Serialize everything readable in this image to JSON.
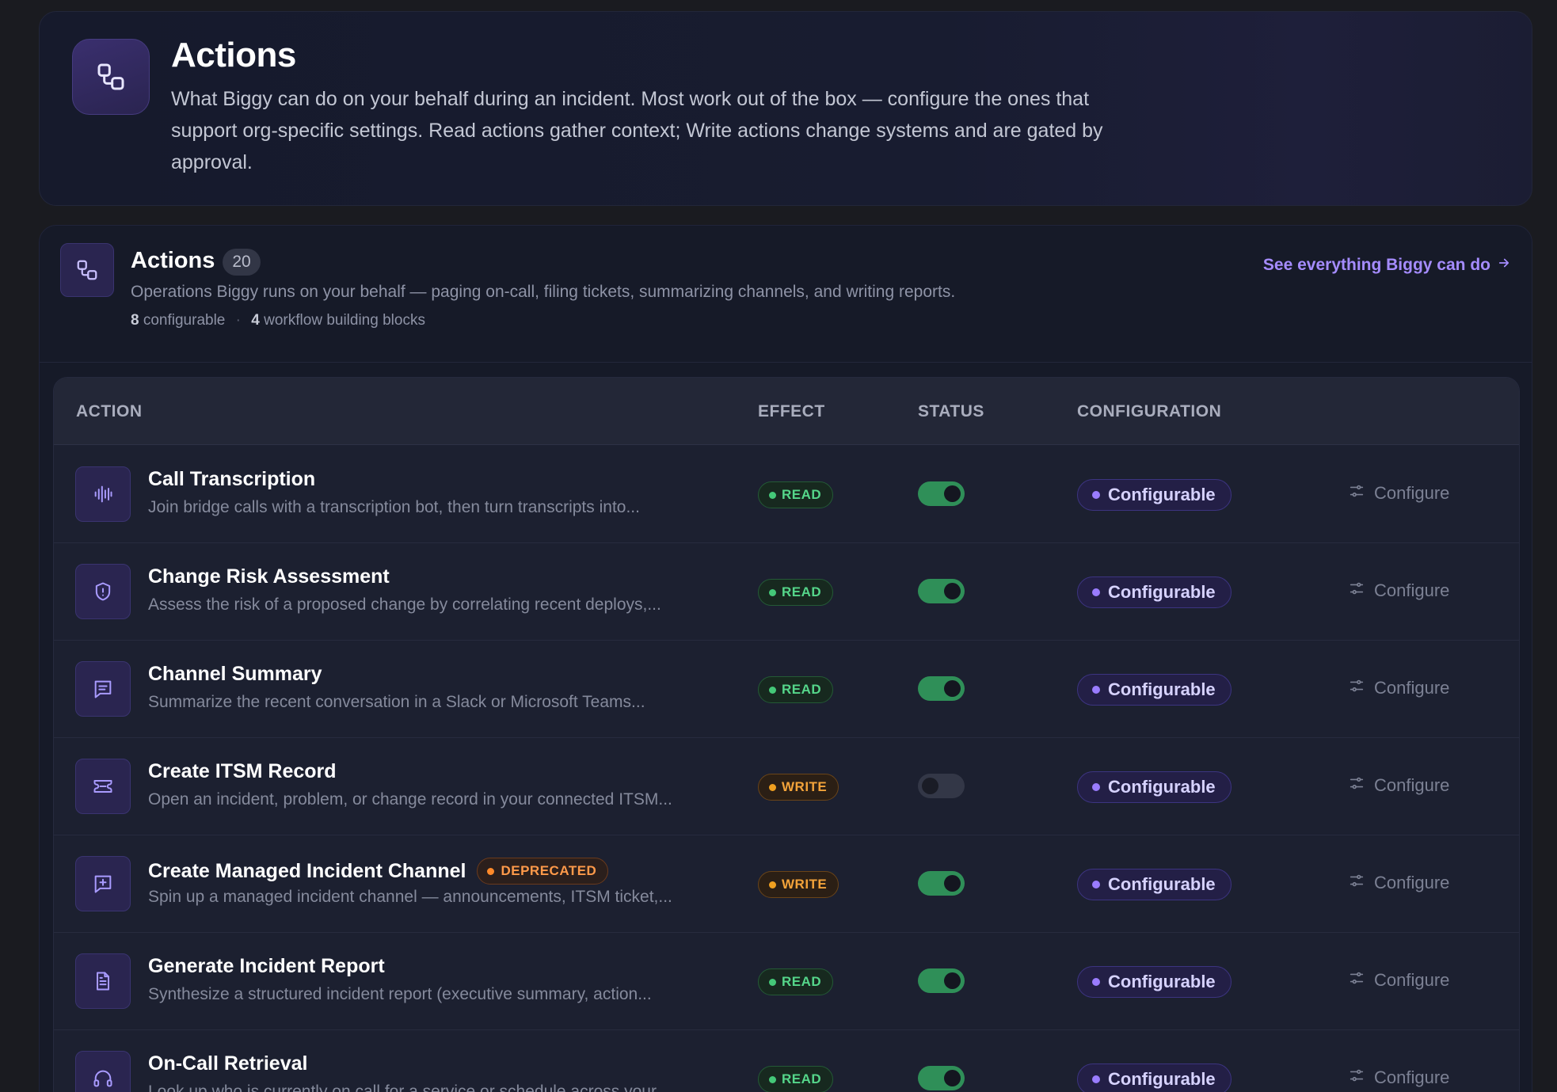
{
  "hero": {
    "title": "Actions",
    "description": "What Biggy can do on your behalf during an incident. Most work out of the box — configure the ones that support org-specific settings. Read actions gather context; Write actions change systems and are gated by approval.",
    "icon": "workflow-icon"
  },
  "panel": {
    "title": "Actions",
    "count": "20",
    "subtitle": "Operations Biggy runs on your behalf — paging on-call, filing tickets, summarizing channels, and writing reports.",
    "configurable_count": "8",
    "configurable_label": "configurable",
    "separator": "·",
    "blocks_count": "4",
    "blocks_label": "workflow building blocks",
    "see_link": "See everything Biggy can do",
    "icon": "workflow-icon"
  },
  "table": {
    "headers": {
      "action": "ACTION",
      "effect": "EFFECT",
      "status": "STATUS",
      "configuration": "CONFIGURATION"
    },
    "rows": [
      {
        "name": "Call Transcription",
        "desc": "Join bridge calls with a transcription bot, then turn transcripts into...",
        "effect": "READ",
        "enabled": true,
        "config": "Configurable",
        "action": "Configure",
        "icon": "audio-waveform-icon",
        "badge": ""
      },
      {
        "name": "Change Risk Assessment",
        "desc": "Assess the risk of a proposed change by correlating recent deploys,...",
        "effect": "READ",
        "enabled": true,
        "config": "Configurable",
        "action": "Configure",
        "icon": "shield-alert-icon",
        "badge": ""
      },
      {
        "name": "Channel Summary",
        "desc": "Summarize the recent conversation in a Slack or Microsoft Teams...",
        "effect": "READ",
        "enabled": true,
        "config": "Configurable",
        "action": "Configure",
        "icon": "message-text-icon",
        "badge": ""
      },
      {
        "name": "Create ITSM Record",
        "desc": "Open an incident, problem, or change record in your connected ITSM...",
        "effect": "WRITE",
        "enabled": false,
        "config": "Configurable",
        "action": "Configure",
        "icon": "ticket-icon",
        "badge": ""
      },
      {
        "name": "Create Managed Incident Channel",
        "desc": "Spin up a managed incident channel — announcements, ITSM ticket,...",
        "effect": "WRITE",
        "enabled": true,
        "config": "Configurable",
        "action": "Configure",
        "icon": "message-plus-icon",
        "badge": "DEPRECATED"
      },
      {
        "name": "Generate Incident Report",
        "desc": "Synthesize a structured incident report (executive summary, action...",
        "effect": "READ",
        "enabled": true,
        "config": "Configurable",
        "action": "Configure",
        "icon": "file-text-icon",
        "badge": ""
      },
      {
        "name": "On-Call Retrieval",
        "desc": "Look up who is currently on call for a service or schedule across your...",
        "effect": "READ",
        "enabled": true,
        "config": "Configurable",
        "action": "Configure",
        "icon": "headset-icon",
        "badge": ""
      }
    ]
  },
  "colors": {
    "accent": "#a58cff",
    "read": "#55d68a",
    "write": "#f3a33a",
    "deprecated": "#ff9a4a",
    "toggle_on": "#2f8f58"
  }
}
